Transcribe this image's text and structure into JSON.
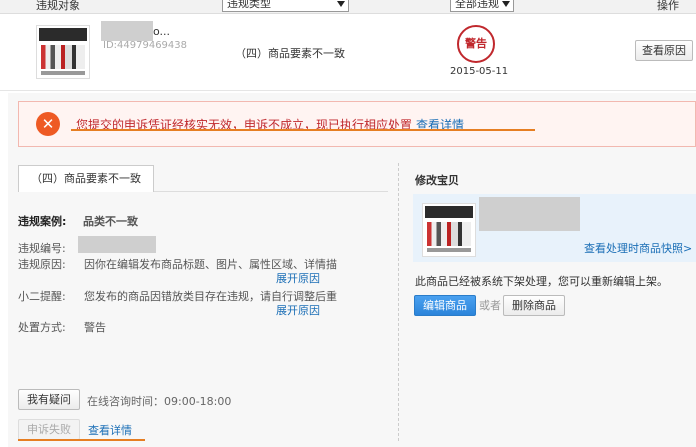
{
  "header": {
    "col_object": "违规对象",
    "col_type": "违规类型",
    "col_status": "全部违规",
    "col_action": "操作"
  },
  "record": {
    "item_name_suffix": "o...",
    "item_id": "ID:44979469438",
    "violation_type": "（四）商品要素不一致",
    "penalty_stamp": "警告",
    "date": "2015-05-11",
    "view_reason_label": "查看原因"
  },
  "alert": {
    "icon": "x-circle-icon",
    "message": "您提交的申诉凭证经核实无效，申诉不成立，现已执行相应处置",
    "link_label": "查看详情"
  },
  "detail": {
    "tab_label": "（四）商品要素不一致",
    "case_label": "违规案例:",
    "case_value": "品类不一致",
    "number_label": "违规编号:",
    "reason_label": "违规原因:",
    "reason_value": "因你在编辑发布商品标题、图片、属性区域、详情描",
    "expand_label_1": "展开原因",
    "tip_label": "小二提醒:",
    "tip_value": "您发布的商品因错放类目存在违规，请自行调整后重",
    "expand_label_2": "展开原因",
    "penalty_label": "处置方式:",
    "penalty_value": "警告",
    "ask_button": "我有疑问",
    "hours_text": "在线咨询时间：09:00-18:00",
    "fail_button": "申诉失败",
    "detail_link": "查看详情"
  },
  "fix": {
    "title": "修改宝贝",
    "snapshot_link": "查看处理时商品快照>",
    "message": "此商品已经被系统下架处理，您可以重新编辑上架。",
    "edit_button": "编辑商品",
    "or_text": "或者",
    "delete_button": "删除商品"
  }
}
